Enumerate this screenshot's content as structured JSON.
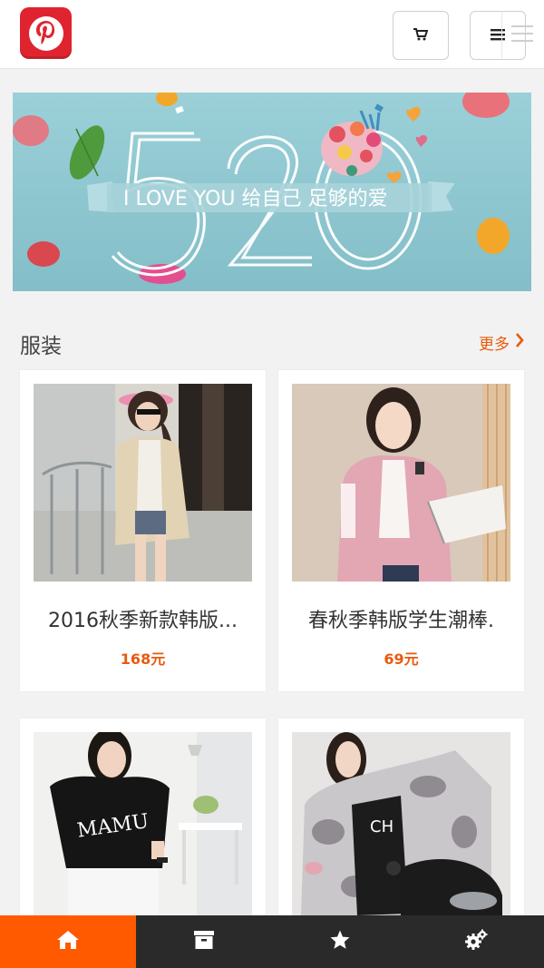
{
  "header": {
    "logo": "pinterest-logo",
    "cart_icon": "cart-icon",
    "menu_icon": "menu-icon"
  },
  "banner": {
    "big_number": "520",
    "tagline": "I LOVE YOU 给自己 足够的爱"
  },
  "section": {
    "title": "服装",
    "more_label": "更多"
  },
  "products": [
    {
      "name": "2016秋季新款韩版...",
      "price": "168元"
    },
    {
      "name": "春秋季韩版学生潮棒.",
      "price": "69元"
    },
    {
      "name": "",
      "price": ""
    },
    {
      "name": "",
      "price": ""
    }
  ],
  "bottom_nav": [
    {
      "icon": "home-icon",
      "active": true
    },
    {
      "icon": "archive-icon",
      "active": false
    },
    {
      "icon": "star-icon",
      "active": false
    },
    {
      "icon": "gears-icon",
      "active": false
    }
  ],
  "colors": {
    "accent": "#ff5a00",
    "price": "#e95a0c",
    "logo_red": "#e0242f",
    "nav_bg": "#2a2a2a"
  }
}
